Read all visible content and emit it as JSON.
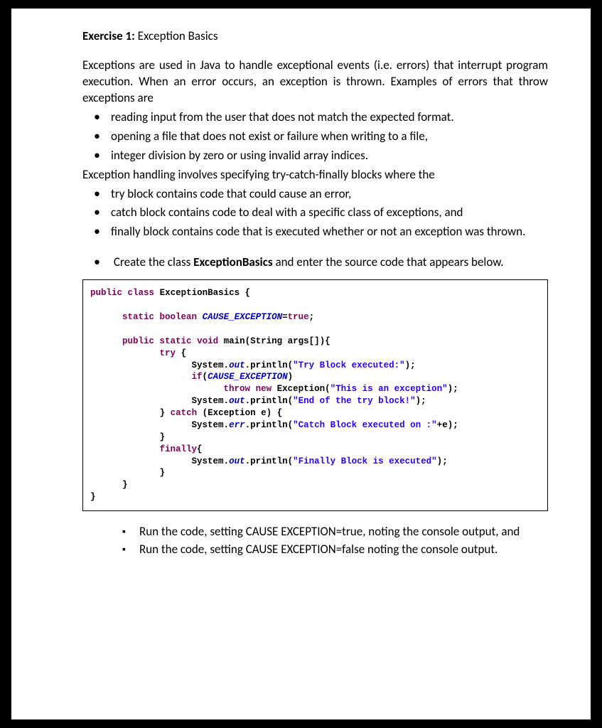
{
  "heading": {
    "label": "Exercise 1:",
    "title": " Exception Basics"
  },
  "intro1": "Exceptions are used in Java to handle exceptional events (i.e. errors) that interrupt program execution. When an error occurs, an exception is thrown. Examples of errors that throw exceptions are",
  "bulletsA": {
    "b0": "reading input from the user that does not match the expected format.",
    "b1": "opening a file that does not exist or failure when writing to a file,",
    "b2": "integer division by zero or using invalid array indices."
  },
  "intro2": "Exception handling involves specifying try-catch-finally blocks where the",
  "bulletsB": {
    "b0": "try block contains code that could cause an error,",
    "b1": "catch block contains code to deal with a specific class of exceptions, and",
    "b2": "finally block contains code that is executed whether or not an exception was thrown."
  },
  "task": {
    "prefix": "Create the class ",
    "classname": "ExceptionBasics",
    "suffix": " and enter the source code that appears below."
  },
  "code": {
    "kw_public": "public",
    "kw_class": "class",
    "cls": "ExceptionBasics",
    "lb": "{",
    "rb": "}",
    "kw_static": "static",
    "kw_boolean": "boolean",
    "const": "CAUSE_EXCEPTION",
    "eq": "=",
    "kw_true": "true",
    "semi": ";",
    "kw_void": "void",
    "main": "main",
    "lp": "(",
    "rp": ")",
    "String": "String",
    "args": "args[]",
    "kw_try": "try",
    "System": "System",
    "dot": ".",
    "out": "out",
    "err": "err",
    "println": "println",
    "str1": "\"Try Block executed:\"",
    "kw_if": "if",
    "kw_throw": "throw",
    "kw_new": "new",
    "Exception": "Exception",
    "str2": "\"This is an exception\"",
    "str3": "\"End of the try block!\"",
    "kw_catch": "catch",
    "evar": "e",
    "str4": "\"Catch Block executed on :\"",
    "plus": "+",
    "kw_finally": "finally",
    "str5": "\"Finally Block is executed\""
  },
  "run": {
    "r0": "Run the code, setting CAUSE EXCEPTION=true, noting the console output, and",
    "r1": "Run the code, setting CAUSE EXCEPTION=false noting the console output."
  }
}
